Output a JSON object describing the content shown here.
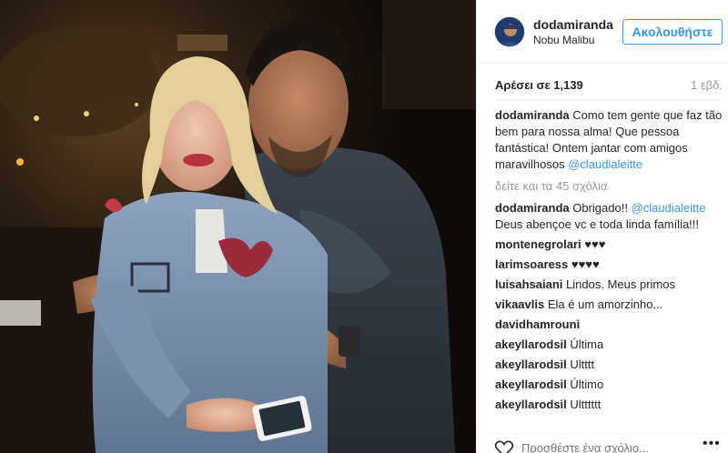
{
  "post": {
    "username": "dodamiranda",
    "location": "Nobu Malibu",
    "follow_label": "Ακολουθήστε",
    "likes": "Αρέσει σε 1,139",
    "time_ago": "1 εβδ.",
    "load_more": "δείτε και τα 45 σχόλια",
    "add_comment_placeholder": "Προσθέστε ένα σχόλιο...",
    "more_icon": "more-horizontal-icon",
    "like_icon": "heart-outline-icon"
  },
  "caption": {
    "user": "dodamiranda",
    "text": "Como tem gente que faz tão bem para nossa alma! Que pessoa fantástica! Ontem jantar com amigos maravilhosos",
    "mention": "@claudialeitte"
  },
  "comments": [
    {
      "user": "dodamiranda",
      "pre": "Obrigado!!",
      "mention": "@claudialeitte",
      "text": "Deus abençoe vc e toda linda família!!!"
    },
    {
      "user": "montenegrolari",
      "text": "♥♥♥"
    },
    {
      "user": "larimsoaress",
      "text": "♥♥♥♥"
    },
    {
      "user": "luisahsaiani",
      "text": "Lindos. Meus primos"
    },
    {
      "user": "vikaavlis",
      "text": "Ela é um amorzinho..."
    },
    {
      "user": "davidhamrouni",
      "text": ""
    },
    {
      "user": "akeyllarodsil",
      "text": "Última"
    },
    {
      "user": "akeyllarodsil",
      "text": "Ultttt"
    },
    {
      "user": "akeyllarodsil",
      "text": "Último"
    },
    {
      "user": "akeyllarodsil",
      "text": "Ultttttt"
    }
  ],
  "colors": {
    "link_blue": "#3897f0",
    "text_dark": "#262626",
    "text_gray": "#999999",
    "border": "#efefef"
  }
}
